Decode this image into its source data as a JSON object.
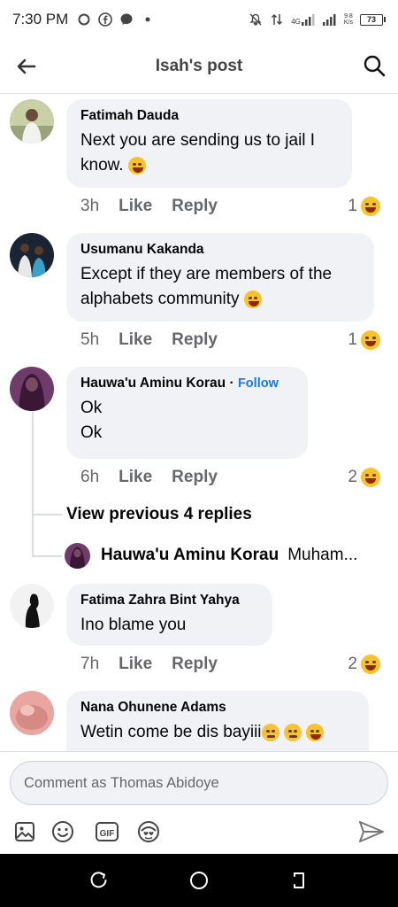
{
  "status_bar": {
    "time": "7:30 PM",
    "network": "4G",
    "net_speed_value": "9.8",
    "net_speed_unit": "K/s",
    "battery": "73"
  },
  "header": {
    "title": "Isah's post"
  },
  "comments": [
    {
      "author": "Fatimah Dauda",
      "text": "Next you are sending us to jail I know.",
      "emoji": "rofl-emoji",
      "time": "3h",
      "like": "Like",
      "reply": "Reply",
      "reactions": "1"
    },
    {
      "author": "Usumanu Kakanda",
      "text": "Except if they are members of the alphabets community",
      "emoji": "tears-of-joy-emoji",
      "time": "5h",
      "like": "Like",
      "reply": "Reply",
      "reactions": "1"
    },
    {
      "author": "Hauwa'u Aminu Korau",
      "separator": "·",
      "follow": "Follow",
      "line1": "Ok",
      "line2": "Ok",
      "time": "6h",
      "like": "Like",
      "reply": "Reply",
      "reactions": "2"
    },
    {
      "author": "Fatima Zahra Bint Yahya",
      "text": "Ino blame you",
      "time": "7h",
      "like": "Like",
      "reply": "Reply",
      "reactions": "2"
    },
    {
      "author": "Nana Ohunene Adams",
      "text": "Wetin come be dis bayiii"
    }
  ],
  "thread": {
    "view_previous": "View previous 4 replies",
    "reply_author": "Hauwa'u Aminu Korau",
    "reply_snippet": "Muham..."
  },
  "composer": {
    "placeholder": "Comment as Thomas Abidoye",
    "tools": [
      "photo-icon",
      "emoji-icon",
      "gif-icon",
      "avatar-sticker-icon"
    ],
    "send_icon": "send-icon"
  },
  "colors": {
    "bubble": "#f0f2f5",
    "link": "#1877f2",
    "meta": "#65676b"
  }
}
